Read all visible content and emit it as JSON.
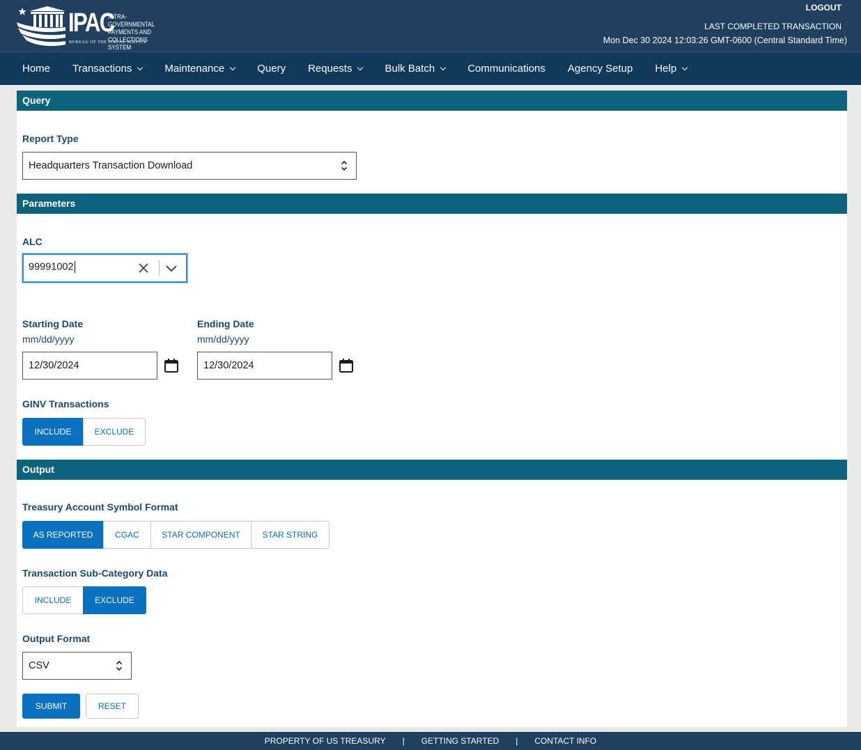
{
  "header": {
    "logo_text": "IPAC",
    "logo_subtitle": [
      "INTRA-GOVERNMENTAL",
      "PAYMENTS AND",
      "COLLECTIONS SYSTEM"
    ],
    "logo_bureau": "BUREAU OF THE FISCAL SERVICE",
    "logout_label": "LOGOUT",
    "last_txn_label": "LAST COMPLETED TRANSACTION",
    "last_txn_time": "Mon Dec 30 2024 12:03:26 GMT-0600 (Central Standard Time)"
  },
  "nav": {
    "items": [
      {
        "label": "Home",
        "dropdown": false
      },
      {
        "label": "Transactions",
        "dropdown": true
      },
      {
        "label": "Maintenance",
        "dropdown": true
      },
      {
        "label": "Query",
        "dropdown": false
      },
      {
        "label": "Requests",
        "dropdown": true
      },
      {
        "label": "Bulk Batch",
        "dropdown": true
      },
      {
        "label": "Communications",
        "dropdown": false
      },
      {
        "label": "Agency Setup",
        "dropdown": false
      },
      {
        "label": "Help",
        "dropdown": true
      }
    ]
  },
  "query": {
    "section_title": "Query",
    "report_type_label": "Report Type",
    "report_type_value": "Headquarters Transaction Download"
  },
  "parameters": {
    "section_title": "Parameters",
    "alc_label": "ALC",
    "alc_value": "99991002",
    "start_label": "Starting Date",
    "start_hint": "mm/dd/yyyy",
    "start_value": "12/30/2024",
    "end_label": "Ending Date",
    "end_hint": "mm/dd/yyyy",
    "end_value": "12/30/2024",
    "ginv_label": "GINV Transactions",
    "ginv_options": [
      "INCLUDE",
      "EXCLUDE"
    ],
    "ginv_selected": "INCLUDE"
  },
  "output": {
    "section_title": "Output",
    "tas_label": "Treasury Account Symbol Format",
    "tas_options": [
      "AS REPORTED",
      "CGAC",
      "STAR COMPONENT",
      "STAR STRING"
    ],
    "tas_selected": "AS REPORTED",
    "subcat_label": "Transaction Sub-Category Data",
    "subcat_options": [
      "INCLUDE",
      "EXCLUDE"
    ],
    "subcat_selected": "EXCLUDE",
    "format_label": "Output Format",
    "format_value": "CSV",
    "submit_label": "SUBMIT",
    "reset_label": "RESET"
  },
  "footer": {
    "links": [
      "PROPERTY OF US TREASURY",
      "GETTING STARTED",
      "CONTACT INFO"
    ],
    "separator": "|"
  },
  "colors": {
    "header_bg": "#213f5f",
    "nav_bg": "#10375c",
    "section_bar": "#0d627c",
    "label": "#1a4870",
    "primary_button": "#0a70c0",
    "focus_border": "#2e8bd6"
  }
}
